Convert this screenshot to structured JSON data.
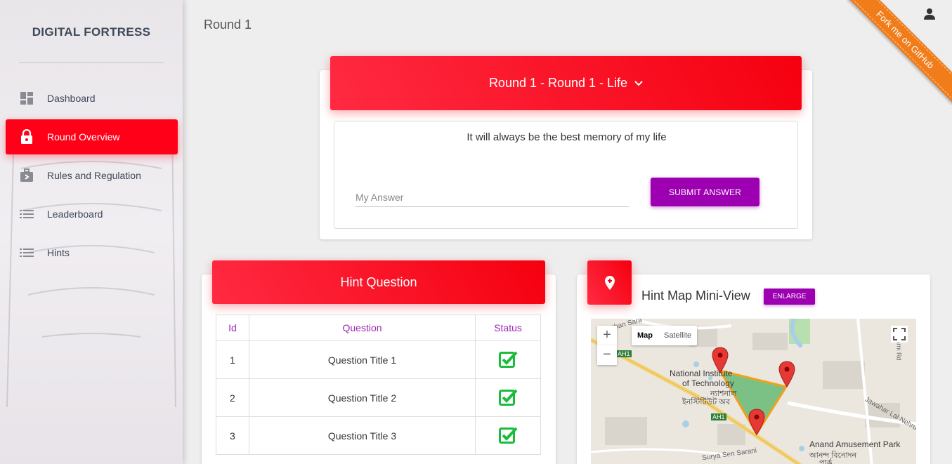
{
  "app": {
    "brand": "DIGITAL FORTRESS",
    "page_title": "Round 1"
  },
  "sidebar": {
    "items": [
      {
        "label": "Dashboard",
        "icon": "dashboard-icon"
      },
      {
        "label": "Round Overview",
        "icon": "lock-icon",
        "active": true
      },
      {
        "label": "Rules and Regulation",
        "icon": "briefcase-icon"
      },
      {
        "label": "Leaderboard",
        "icon": "list-icon"
      },
      {
        "label": "Hints",
        "icon": "list-icon"
      }
    ]
  },
  "ribbon": {
    "text": "Fork me on GitHub"
  },
  "round": {
    "title": "Round 1 - Round 1 - Life",
    "question": "It will always be the best memory of my life",
    "answer_placeholder": "My Answer",
    "answer_value": "",
    "submit_label": "SUBMIT ANSWER"
  },
  "hints": {
    "title": "Hint Question",
    "columns": [
      "Id",
      "Question",
      "Status"
    ],
    "rows": [
      {
        "id": "1",
        "question": "Question Title 1",
        "status": "done"
      },
      {
        "id": "2",
        "question": "Question Title 2",
        "status": "done"
      },
      {
        "id": "3",
        "question": "Question Title 3",
        "status": "done"
      }
    ]
  },
  "map": {
    "title": "Hint Map Mini-View",
    "enlarge_label": "ENLARGE",
    "type_options": [
      "Map",
      "Satellite"
    ],
    "selected_type": "Map",
    "zoom_in": "+",
    "zoom_out": "−",
    "labels": {
      "nit1": "National Institute",
      "nit2": "of Technology",
      "nit_bn": "ন্যাশনাল",
      "nit_bn2": "ইনস্টিটিউট অব",
      "ah1a": "AH1",
      "ah1b": "AH1",
      "park": "Anand Amusement Park",
      "park_bn": "আনন্দ বিনোদন",
      "park_bn2": "পার্ক",
      "road1": "Surya Sen Sarani",
      "road2": "Jawahar Lal Nehru",
      "road3": "than Sara",
      "road4": "arni Rd"
    }
  },
  "colors": {
    "accent_red": "#ff0018",
    "purple": "#9c00b0",
    "ribbon": "#f07c1a",
    "check_green": "#1abc3c"
  }
}
